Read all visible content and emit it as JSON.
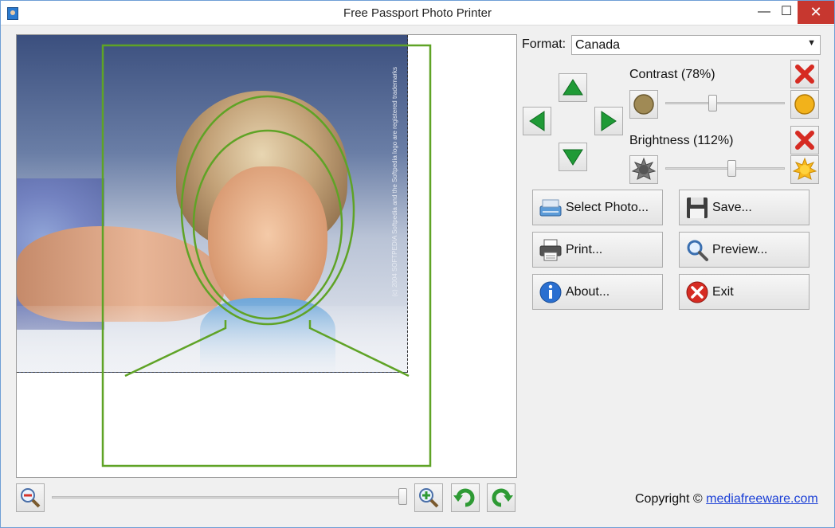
{
  "window": {
    "title": "Free Passport Photo Printer",
    "minimize": "—",
    "maximize": "☐",
    "close": "✕"
  },
  "preview": {
    "watermark": "(c) 2004 SOFTPEDIA Softpedia and the Softpedia logo are registered trademarks"
  },
  "format": {
    "label": "Format:",
    "value": "Canada"
  },
  "contrast": {
    "label": "Contrast (78%)",
    "percent": 78
  },
  "brightness": {
    "label": "Brightness (112%)",
    "percent": 112
  },
  "buttons": {
    "select_photo": "Select Photo...",
    "save": "Save...",
    "print": "Print...",
    "preview": "Preview...",
    "about": "About...",
    "exit": "Exit"
  },
  "zoom": {
    "level_fraction": 1.0
  },
  "footer": {
    "copyright_text": "Copyright ©",
    "link_text": "mediafreeware.com"
  },
  "colors": {
    "guide_green": "#5fa326",
    "arrow_green": "#1f9a36",
    "delete_red": "#d62b22",
    "link_blue": "#1a3fd6"
  }
}
